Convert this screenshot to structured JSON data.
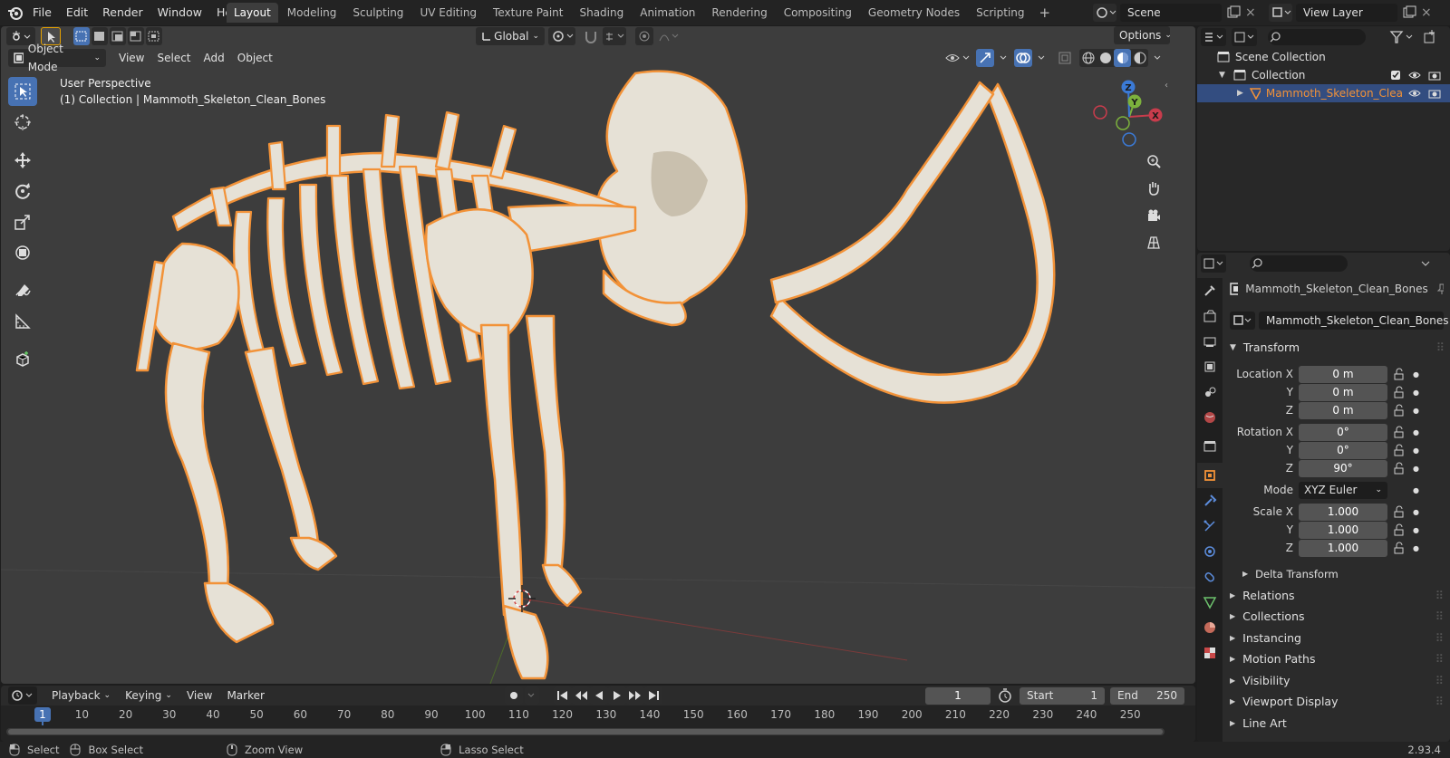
{
  "menu": [
    "File",
    "Edit",
    "Render",
    "Window",
    "Help"
  ],
  "workspaces": [
    "Layout",
    "Modeling",
    "Sculpting",
    "UV Editing",
    "Texture Paint",
    "Shading",
    "Animation",
    "Rendering",
    "Compositing",
    "Geometry Nodes",
    "Scripting"
  ],
  "active_workspace": "Layout",
  "scene_name": "Scene",
  "view_layer": "View Layer",
  "viewport": {
    "mode": "Object Mode",
    "menus": [
      "View",
      "Select",
      "Add",
      "Object"
    ],
    "transform_orientation": "Global",
    "options_label": "Options",
    "overlay_title": "User Perspective",
    "overlay_subtitle": "(1) Collection | Mammoth_Skeleton_Clean_Bones",
    "gizmo_axes": {
      "x": "X",
      "y": "Y",
      "z": "Z"
    }
  },
  "outliner": {
    "rows": [
      {
        "label": "Scene Collection"
      },
      {
        "label": "Collection"
      },
      {
        "label": "Mammoth_Skeleton_Clea"
      }
    ]
  },
  "properties": {
    "object_name": "Mammoth_Skeleton_Clean_Bones",
    "data_name": "Mammoth_Skeleton_Clean_Bones",
    "transform_title": "Transform",
    "location": {
      "label_x": "Location X",
      "label_y": "Y",
      "label_z": "Z",
      "x": "0 m",
      "y": "0 m",
      "z": "0 m"
    },
    "rotation": {
      "label_x": "Rotation X",
      "label_y": "Y",
      "label_z": "Z",
      "x": "0°",
      "y": "0°",
      "z": "90°"
    },
    "mode_label": "Mode",
    "mode_value": "XYZ Euler",
    "scale": {
      "label_x": "Scale X",
      "label_y": "Y",
      "label_z": "Z",
      "x": "1.000",
      "y": "1.000",
      "z": "1.000"
    },
    "delta_transform": "Delta Transform",
    "sections": [
      "Relations",
      "Collections",
      "Instancing",
      "Motion Paths",
      "Visibility",
      "Viewport Display",
      "Line Art"
    ]
  },
  "timeline": {
    "menus": [
      "Playback",
      "Keying",
      "View",
      "Marker"
    ],
    "current_frame": "1",
    "start_label": "Start",
    "start": "1",
    "end_label": "End",
    "end": "250",
    "ruler": [
      "1",
      "10",
      "20",
      "30",
      "40",
      "50",
      "60",
      "70",
      "80",
      "90",
      "100",
      "110",
      "120",
      "130",
      "140",
      "150",
      "160",
      "170",
      "180",
      "190",
      "200",
      "210",
      "220",
      "230",
      "240",
      "250"
    ]
  },
  "statusbar": {
    "select": "Select",
    "box_select": "Box Select",
    "zoom_view": "Zoom View",
    "lasso_select": "Lasso Select",
    "version": "2.93.4"
  },
  "colors": {
    "accent": "#4772b3",
    "selection_outline": "#f29238",
    "bone": "#e6e1d6"
  }
}
